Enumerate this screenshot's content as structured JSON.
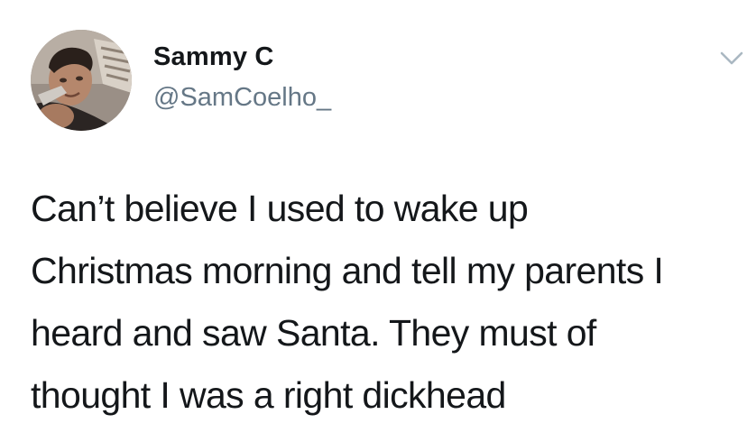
{
  "tweet": {
    "author": {
      "display_name": "Sammy C",
      "handle": "@SamCoelho_"
    },
    "text_lines": [
      "Can’t believe I used to wake up",
      "Christmas morning and tell my parents I",
      "heard and saw Santa. They must of",
      "thought I was a right dickhead"
    ],
    "menu_icon": "chevron-down-icon",
    "avatar_icon": "profile-photo"
  },
  "colors": {
    "text": "#14171a",
    "handle": "#657786",
    "caret": "#aab8c2",
    "background": "#ffffff"
  }
}
